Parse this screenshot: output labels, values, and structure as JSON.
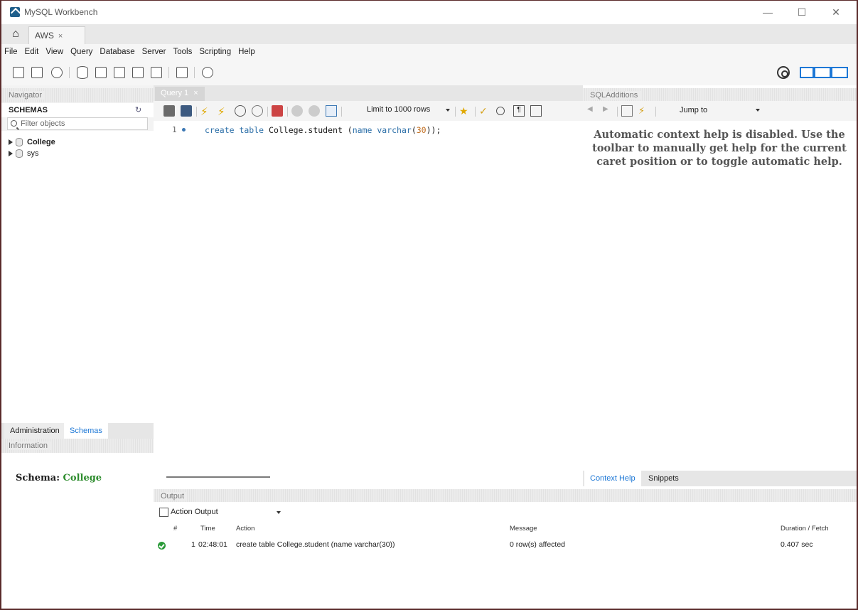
{
  "window": {
    "title": "MySQL Workbench",
    "minimize": "—",
    "maximize": "☐",
    "close": "✕"
  },
  "tabs": {
    "connection": "AWS",
    "close": "×"
  },
  "menu": [
    "File",
    "Edit",
    "View",
    "Query",
    "Database",
    "Server",
    "Tools",
    "Scripting",
    "Help"
  ],
  "navigator": {
    "header": "Navigator",
    "schemas_title": "SCHEMAS",
    "filter_placeholder": "Filter objects",
    "schemas": [
      {
        "name": "College",
        "bold": true
      },
      {
        "name": "sys",
        "bold": false
      }
    ],
    "tabs": [
      "Administration",
      "Schemas"
    ],
    "active_tab": "Schemas"
  },
  "information": {
    "header": "Information",
    "schema_label": "Schema:",
    "schema_value": "College"
  },
  "editor": {
    "tab": "Query 1",
    "tab_close": "×",
    "limit": "Limit to 1000 rows",
    "line_number": "1",
    "code": {
      "kw1": "create table",
      "ident": " College.student (",
      "kw2": "name",
      "kw3": " varchar",
      "paren": "(",
      "num": "30",
      "end": "));"
    }
  },
  "sql_additions": {
    "header": "SQLAdditions",
    "jump_to": "Jump to",
    "help_text": "Automatic context help is disabled. Use the toolbar to manually get help for the current caret position or to toggle automatic help.",
    "tabs": [
      "Context Help",
      "Snippets"
    ]
  },
  "output": {
    "header": "Output",
    "mode": "Action Output",
    "columns": [
      "#",
      "Time",
      "Action",
      "Message",
      "Duration / Fetch"
    ],
    "rows": [
      {
        "num": "1",
        "time": "02:48:01",
        "action": "create table College.student (name varchar(30))",
        "message": "0 row(s) affected",
        "duration": "0.407 sec"
      }
    ]
  },
  "colors": {
    "accent": "#1e78d6",
    "success": "#2b9b3a",
    "schema_value": "#2d8c2d"
  }
}
